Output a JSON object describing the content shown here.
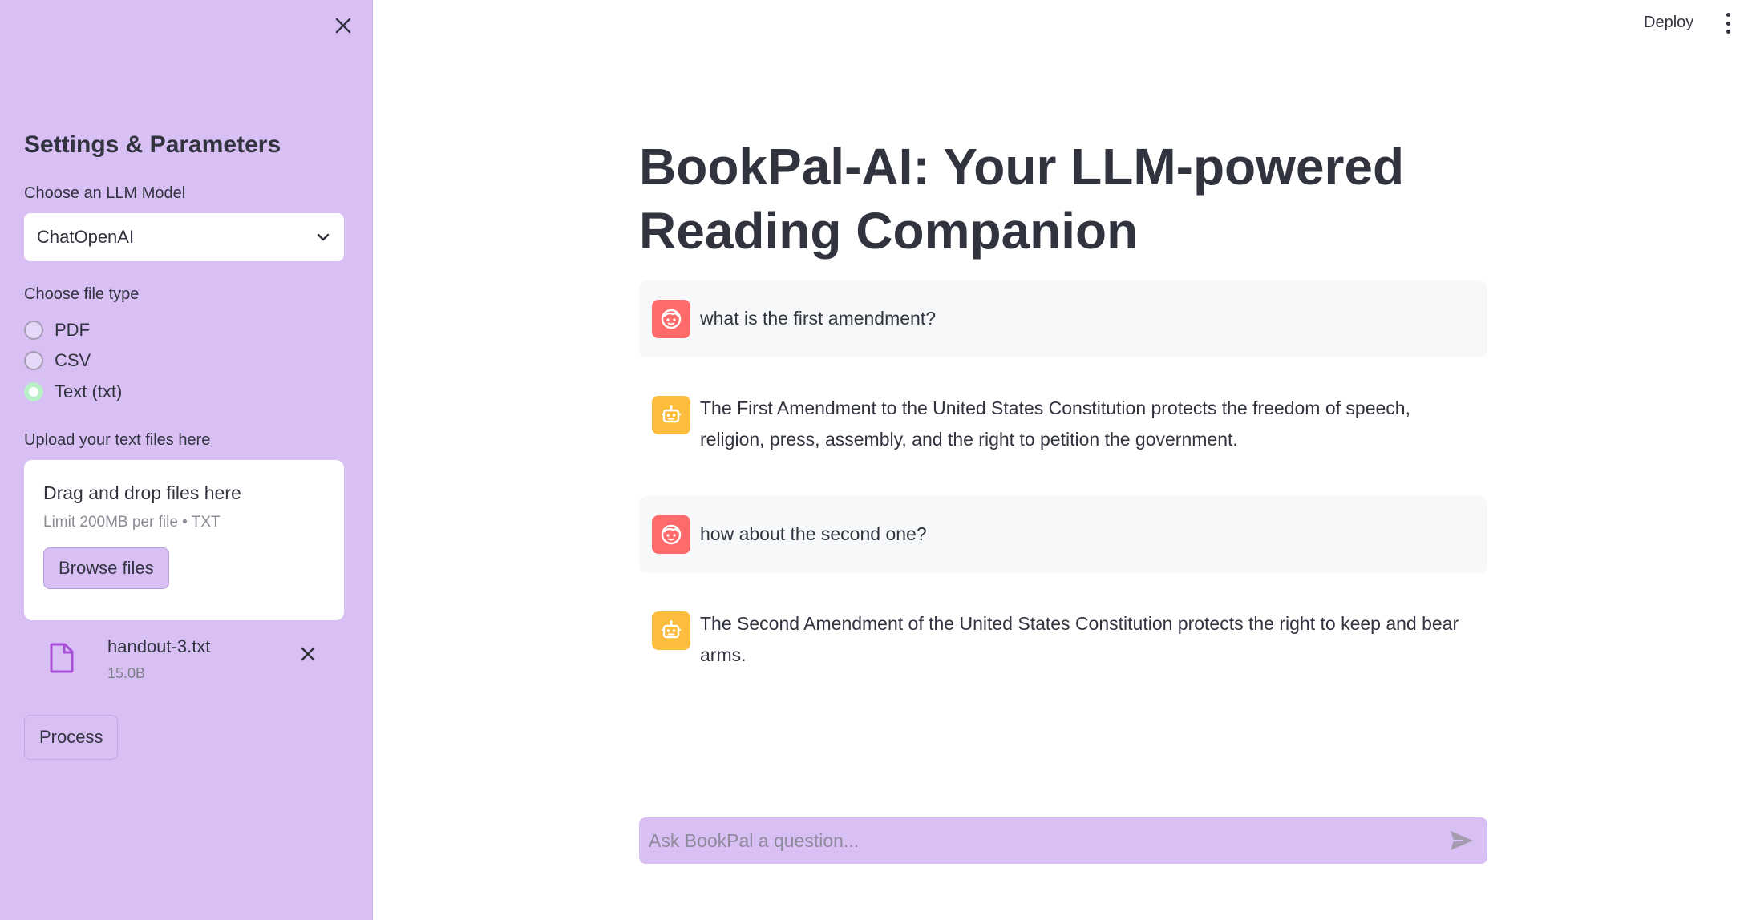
{
  "header": {
    "deploy_label": "Deploy"
  },
  "sidebar": {
    "title": "Settings & Parameters",
    "model_label": "Choose an LLM Model",
    "model_selected": "ChatOpenAI",
    "filetype_label": "Choose file type",
    "filetype_options": [
      {
        "label": "PDF",
        "checked": false
      },
      {
        "label": "CSV",
        "checked": false
      },
      {
        "label": "Text (txt)",
        "checked": true
      }
    ],
    "upload_label": "Upload your text files here",
    "uploader": {
      "title": "Drag and drop files here",
      "limit": "Limit 200MB per file • TXT",
      "browse_label": "Browse files"
    },
    "file": {
      "name": "handout-3.txt",
      "size": "15.0B"
    },
    "process_label": "Process"
  },
  "main": {
    "title": "BookPal-AI: Your LLM-powered Reading Companion",
    "messages": [
      {
        "role": "user",
        "text": "what is the first amendment?"
      },
      {
        "role": "assistant",
        "text": "The First Amendment to the United States Constitution protects the freedom of speech, religion, press, assembly, and the right to petition the government."
      },
      {
        "role": "user",
        "text": "how about the second one?"
      },
      {
        "role": "assistant",
        "text": "The Second Amendment of the United States Constitution protects the right to keep and bear arms."
      }
    ],
    "input_placeholder": "Ask BookPal a question..."
  },
  "colors": {
    "sidebar_bg": "#d8c0f4",
    "user_avatar": "#ff6b6b",
    "bot_avatar": "#fbbd3b",
    "radio_checked": "#b9f0c8",
    "file_icon": "#a64fd6"
  }
}
